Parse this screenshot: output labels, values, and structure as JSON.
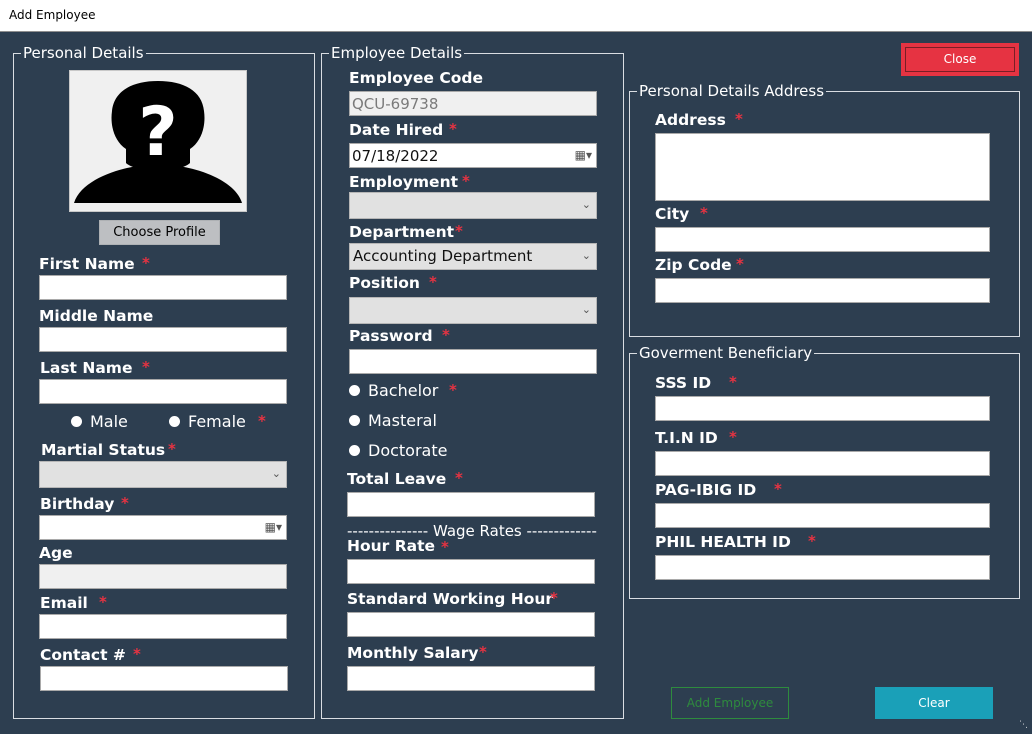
{
  "window": {
    "title": "Add Employee"
  },
  "personal": {
    "legend": "Personal Details",
    "choose_profile": "Choose Profile",
    "first_name": "First Name",
    "middle_name": "Middle Name",
    "last_name": "Last Name",
    "male": "Male",
    "female": "Female",
    "marital_status": "Martial Status",
    "birthday": "Birthday",
    "age": "Age",
    "email": "Email",
    "contact": "Contact #",
    "req": "*"
  },
  "employee": {
    "legend": "Employee Details",
    "code_label": "Employee Code",
    "code_value": "QCU-69738",
    "date_hired_label": "Date Hired",
    "date_hired_value": "07/18/2022",
    "employment_label": "Employment",
    "department_label": "Department",
    "department_value": "Accounting Department",
    "position_label": "Position",
    "password_label": "Password",
    "bachelor": "Bachelor",
    "masteral": "Masteral",
    "doctorate": "Doctorate",
    "total_leave_label": "Total Leave",
    "wage_divider": "--------------- Wage Rates ----------------",
    "hour_rate_label": "Hour Rate",
    "standard_hours_label": "Standard Working Hour",
    "monthly_salary_label": "Monthly Salary"
  },
  "address": {
    "legend": "Personal Details Address",
    "address_label": "Address",
    "city_label": "City",
    "zip_label": "Zip Code"
  },
  "gov": {
    "legend": "Goverment Beneficiary",
    "sss": "SSS ID",
    "tin": "T.I.N ID",
    "pagibig": "PAG-IBIG ID",
    "philhealth": "PHIL HEALTH ID"
  },
  "actions": {
    "close": "Close",
    "add_employee": "Add Employee",
    "clear": "Clear"
  },
  "colors": {
    "background": "#2d3e50",
    "required": "#e63342",
    "close": "#e63342",
    "clear": "#1aa0b8",
    "add_border": "#2e8b3e"
  }
}
